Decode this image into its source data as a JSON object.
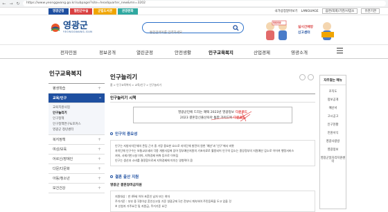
{
  "browser": {
    "url": "https://www.yeonggwang.go.kr/subpage/?site=headquarter_new&mn=3202"
  },
  "top_tabs": [
    {
      "label": "영광군청",
      "color": "#1e4fa0"
    },
    {
      "label": "열린군수실",
      "color": "#d94040"
    },
    {
      "label": "군립도서관",
      "color": "#f0a500"
    },
    {
      "label": "관광문화",
      "color": "#2fa8a0"
    }
  ],
  "util": {
    "gov_label": "국가상징알아보기",
    "lang_label": "LANGUAGE",
    "select1": "읍면/의회/기관/사업소",
    "select2": "유관기관"
  },
  "logo": {
    "name": "영광군",
    "sub": "YEONGGWANG-GUN"
  },
  "search": {
    "placeholder": "통합검색어를 입력하세요"
  },
  "banner": {
    "text1": "청렴영광",
    "text2": "실시간예방",
    "text3": "신고센터"
  },
  "gnb": [
    "전자민원",
    "정보공개",
    "열린군정",
    "안전생활",
    "인구교육복지",
    "산업경제",
    "영광소개"
  ],
  "gnb_active": "인구교육복지",
  "sidebar": {
    "title": "인구교육복지",
    "items_before": [
      {
        "label": "평생학습"
      }
    ],
    "active": {
      "label": "교육/인구"
    },
    "sub": [
      "교육지원사업",
      "인구늘리기",
      "인구정책",
      "인구정책연구&포커스",
      "영광군 청년센터"
    ],
    "sub_current": "인구늘리기",
    "items_after": [
      {
        "label": "복지정책"
      },
      {
        "label": "여성/보육"
      },
      {
        "label": "어르신/장애인"
      },
      {
        "label": "다문/다문화"
      },
      {
        "label": "아동/청소년"
      },
      {
        "label": "보건건강"
      }
    ]
  },
  "content": {
    "title": "인구늘리기",
    "breadcrumb": "홈 > 인구교육복지 > 교육/인구 > 인구늘리기",
    "section_title": "인구늘리기 시책",
    "notice1_text": "영광군민에 드리는 혜택 2023년 영광정보",
    "notice2_text": "2023 결혼장신출산육아 통합 가이드북",
    "download": "다운로드",
    "h1": "인구의 중요성",
    "para": [
      "인구는 지방자치단체의 존립 근거 중 가장 중요한 요소로 자치단체 발전의 원천 '예산'과 '인구'에서 비롯",
      "자치단체 인구수는 보통교부세와 각종 개발사업에 있어 정부예산지원의 기초자료로 활용되어 인구의 감소는 중앙정부의 지원예산 감소로 이어져 행정서비스",
      "저하, 사회기반시설 미약, 지역경제 위축 등으로 이어짐",
      "인구는 생산과 소비를 결정함으로써 지역경제에 미치는 영향력이 큼"
    ],
    "h2": "결혼 출산 지원",
    "sub_h": "영광군 결혼장려금지원",
    "para2": [
      "지원대상 : 만 49세 이하 초혼인 남자 또는 여자",
      "주거기준 : 부부 중 1명이상 혼인신고일 기준 영광군에 1년 전부터 계속하여 주민등록을 두고 있을 것",
      "※ 신청자 거주요건 및 지원금, 주거기준 요건"
    ]
  },
  "right": {
    "title": "자주찾는 메뉴",
    "items": [
      "조직도",
      "정보공개",
      "예산서",
      "고시공고",
      "인구현황",
      "민원서식",
      "영광사랑방",
      "영광정보",
      "영광군일자리지원센터"
    ]
  }
}
